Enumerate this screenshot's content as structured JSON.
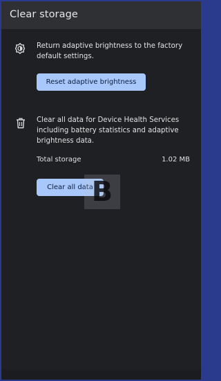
{
  "app_bar": {
    "title": "Clear storage"
  },
  "brightness_section": {
    "icon": "adaptive-brightness-icon",
    "description": "Return adaptive brightness to the factory default settings.",
    "button_label": "Reset adaptive brightness"
  },
  "data_section": {
    "icon": "trash-icon",
    "description": "Clear all data for Device Health Services including battery statistics and adaptive brightness data.",
    "storage_label": "Total storage",
    "storage_value": "1.02 MB",
    "button_label": "Clear all data"
  },
  "watermark": {
    "letter": "B"
  },
  "colors": {
    "background": "#1f2024",
    "app_bar": "#2e3034",
    "button": "#a8c7fa",
    "frame_border": "#2a3a8c"
  }
}
